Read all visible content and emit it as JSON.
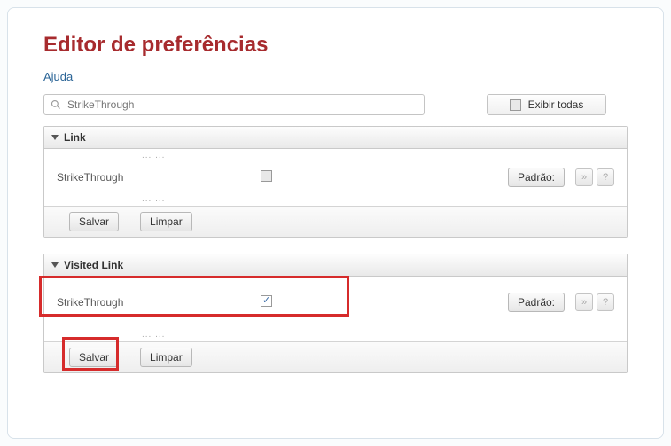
{
  "header": {
    "title": "Editor de preferências",
    "help_label": "Ajuda"
  },
  "search": {
    "value": "StrikeThrough"
  },
  "show_all": {
    "label": "Exibir todas",
    "checked": false
  },
  "sections": [
    {
      "title": "Link",
      "breadcrumb_top": "...  ...",
      "breadcrumb_bottom": "...  ...",
      "row": {
        "label": "StrikeThrough",
        "checked": false
      },
      "default_label": "Padrão:",
      "save_label": "Salvar",
      "clear_label": "Limpar"
    },
    {
      "title": "Visited Link",
      "breadcrumb_top": "",
      "breadcrumb_bottom": "...  ...",
      "row": {
        "label": "StrikeThrough",
        "checked": true
      },
      "default_label": "Padrão:",
      "save_label": "Salvar",
      "clear_label": "Limpar"
    }
  ],
  "icons": {
    "expand": "»",
    "help": "?"
  }
}
